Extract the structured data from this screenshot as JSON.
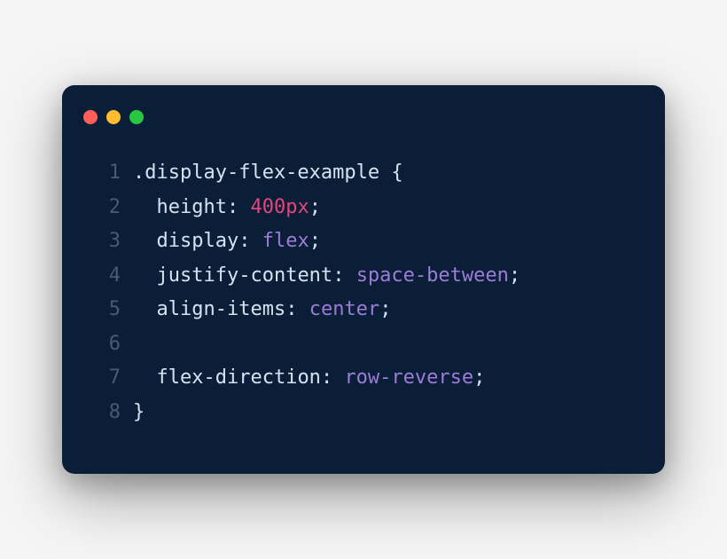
{
  "window": {
    "traffic_lights": {
      "close": "close",
      "minimize": "minimize",
      "zoom": "zoom"
    }
  },
  "colors": {
    "background": "#0a1e38",
    "line_number": "#4a5a72",
    "default": "#d6e2f0",
    "number": "#e5457a",
    "value": "#9d7cd8",
    "tl_red": "#ff5f57",
    "tl_yellow": "#febc2e",
    "tl_green": "#28c840"
  },
  "code": {
    "lines": [
      {
        "num": "1",
        "tokens": [
          {
            "t": ".display-flex-example ",
            "c": "token-default"
          },
          {
            "t": "{",
            "c": "token-punct"
          }
        ]
      },
      {
        "num": "2",
        "tokens": [
          {
            "t": "  ",
            "c": "token-default"
          },
          {
            "t": "height",
            "c": "token-property"
          },
          {
            "t": ": ",
            "c": "token-punct"
          },
          {
            "t": "400px",
            "c": "token-number"
          },
          {
            "t": ";",
            "c": "token-punct"
          }
        ]
      },
      {
        "num": "3",
        "tokens": [
          {
            "t": "  ",
            "c": "token-default"
          },
          {
            "t": "display",
            "c": "token-property"
          },
          {
            "t": ": ",
            "c": "token-punct"
          },
          {
            "t": "flex",
            "c": "token-value"
          },
          {
            "t": ";",
            "c": "token-punct"
          }
        ]
      },
      {
        "num": "4",
        "tokens": [
          {
            "t": "  ",
            "c": "token-default"
          },
          {
            "t": "justify-content",
            "c": "token-property"
          },
          {
            "t": ": ",
            "c": "token-punct"
          },
          {
            "t": "space-between",
            "c": "token-value"
          },
          {
            "t": ";",
            "c": "token-punct"
          }
        ]
      },
      {
        "num": "5",
        "tokens": [
          {
            "t": "  ",
            "c": "token-default"
          },
          {
            "t": "align-items",
            "c": "token-property"
          },
          {
            "t": ": ",
            "c": "token-punct"
          },
          {
            "t": "center",
            "c": "token-value"
          },
          {
            "t": ";",
            "c": "token-punct"
          }
        ]
      },
      {
        "num": "6",
        "tokens": [
          {
            "t": "",
            "c": "token-default"
          }
        ]
      },
      {
        "num": "7",
        "tokens": [
          {
            "t": "  ",
            "c": "token-default"
          },
          {
            "t": "flex-direction",
            "c": "token-property"
          },
          {
            "t": ": ",
            "c": "token-punct"
          },
          {
            "t": "row-reverse",
            "c": "token-value"
          },
          {
            "t": ";",
            "c": "token-punct"
          }
        ]
      },
      {
        "num": "8",
        "tokens": [
          {
            "t": "}",
            "c": "token-punct"
          }
        ]
      }
    ]
  }
}
